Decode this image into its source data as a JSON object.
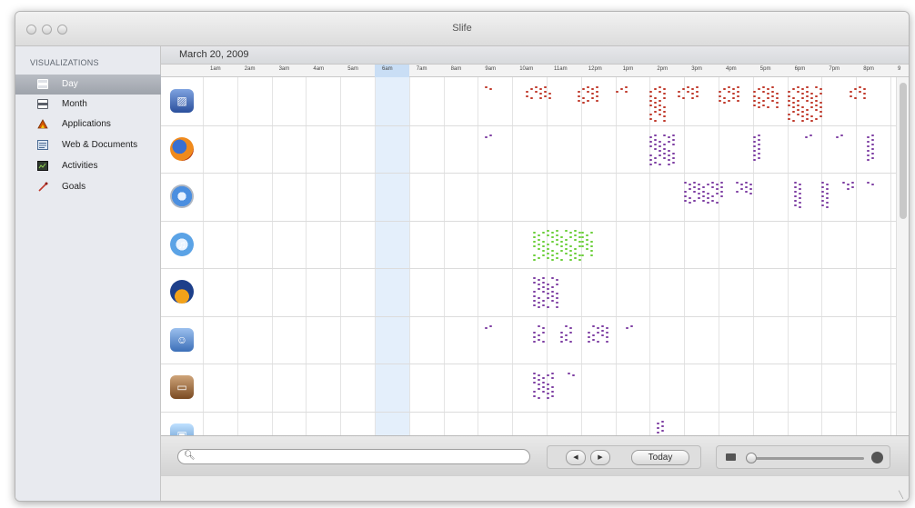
{
  "window": {
    "title": "Slife"
  },
  "sidebar": {
    "heading": "VISUALIZATIONS",
    "items": [
      {
        "label": "Day",
        "icon": "calendar-day-icon",
        "selected": true
      },
      {
        "label": "Month",
        "icon": "calendar-month-icon"
      },
      {
        "label": "Applications",
        "icon": "applications-icon"
      },
      {
        "label": "Web & Documents",
        "icon": "web-documents-icon"
      },
      {
        "label": "Activities",
        "icon": "activities-icon"
      },
      {
        "label": "Goals",
        "icon": "goals-icon"
      }
    ]
  },
  "timeline": {
    "date": "March 20, 2009",
    "hours": [
      "1am",
      "2am",
      "3am",
      "4am",
      "5am",
      "6am",
      "7am",
      "8am",
      "9am",
      "10am",
      "11am",
      "12pm",
      "1pm",
      "2pm",
      "3pm",
      "4pm",
      "5pm",
      "6pm",
      "7pm",
      "8pm",
      "9"
    ],
    "highlighted_hour": "6am",
    "rows": [
      {
        "app": "preview-app-icon",
        "color": "#c0392b",
        "segments": [
          [
            9.2,
            9.5,
            1
          ],
          [
            10.4,
            11.2,
            3
          ],
          [
            11.9,
            12.6,
            4
          ],
          [
            13.0,
            13.4,
            2
          ],
          [
            14.0,
            14.5,
            8
          ],
          [
            14.8,
            15.5,
            3
          ],
          [
            16.0,
            16.6,
            4
          ],
          [
            17.0,
            17.8,
            5
          ],
          [
            18.0,
            19.0,
            8
          ],
          [
            19.8,
            20.3,
            3
          ]
        ]
      },
      {
        "app": "firefox-icon",
        "color": "#7e3fa3",
        "segments": [
          [
            9.2,
            9.4,
            1
          ],
          [
            14.0,
            14.8,
            7
          ],
          [
            17.0,
            17.3,
            6
          ],
          [
            18.5,
            18.8,
            1
          ],
          [
            19.4,
            19.6,
            1
          ],
          [
            20.3,
            20.5,
            6
          ]
        ]
      },
      {
        "app": "safari-icon",
        "color": "#7e3fa3",
        "segments": [
          [
            15.0,
            16.2,
            5
          ],
          [
            16.5,
            17.0,
            3
          ],
          [
            18.2,
            18.5,
            6
          ],
          [
            19.0,
            19.3,
            6
          ],
          [
            19.6,
            20.0,
            2
          ],
          [
            20.3,
            20.5,
            1
          ]
        ]
      },
      {
        "app": "itunes-icon",
        "color": "#6ccf3a",
        "segments": [
          [
            10.6,
            12.0,
            7
          ],
          [
            12.0,
            12.4,
            6
          ]
        ]
      },
      {
        "app": "audio-app-icon",
        "color": "#7e3fa3",
        "segments": [
          [
            10.6,
            11.4,
            7
          ]
        ]
      },
      {
        "app": "finder-icon",
        "color": "#7e3fa3",
        "segments": [
          [
            9.2,
            9.4,
            1
          ],
          [
            10.6,
            11.0,
            4
          ],
          [
            11.4,
            11.8,
            4
          ],
          [
            12.2,
            12.9,
            4
          ],
          [
            13.3,
            13.5,
            1
          ]
        ]
      },
      {
        "app": "keynote-icon",
        "color": "#7e3fa3",
        "segments": [
          [
            10.6,
            11.2,
            6
          ],
          [
            11.6,
            11.8,
            1
          ]
        ]
      },
      {
        "app": "image-app-icon",
        "color": "#7e3fa3",
        "segments": [
          [
            14.2,
            14.5,
            3
          ]
        ]
      }
    ]
  },
  "toolbar": {
    "search_placeholder": "",
    "prev_label": "◀",
    "next_label": "▶",
    "today_label": "Today",
    "zoom_level": 0.0
  }
}
